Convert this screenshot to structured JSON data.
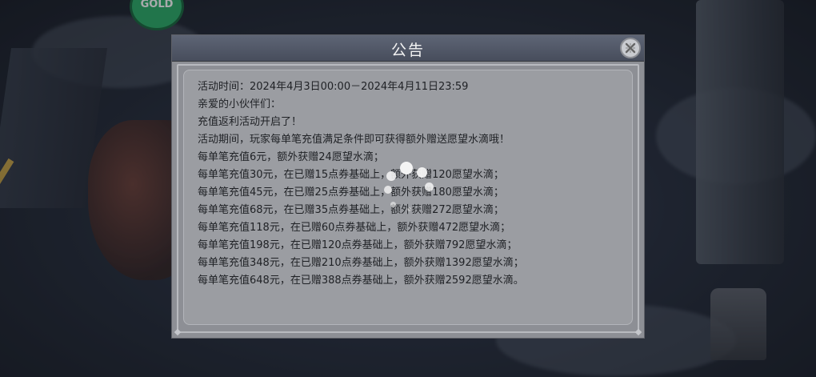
{
  "badge": {
    "label": "GOLD"
  },
  "dialog": {
    "title": "公告",
    "close_icon": "close-icon",
    "lines": [
      "活动时间：2024年4月3日00:00－2024年4月11日23:59",
      "亲爱的小伙伴们：",
      "充值返利活动开启了！",
      "活动期间，玩家每单笔充值满足条件即可获得额外赠送愿望水滴哦！",
      "每单笔充值6元，额外获赠24愿望水滴；",
      "每单笔充值30元，在已赠15点券基础上，额外获赠120愿望水滴；",
      "每单笔充值45元，在已赠25点券基础上，额外获赠180愿望水滴；",
      "每单笔充值68元，在已赠35点券基础上，额外获赠272愿望水滴；",
      "每单笔充值118元，在已赠60点券基础上，额外获赠472愿望水滴；",
      "每单笔充值198元，在已赠120点券基础上，额外获赠792愿望水滴；",
      "每单笔充值348元，在已赠210点券基础上，额外获赠1392愿望水滴；",
      "每单笔充值648元，在已赠388点券基础上，额外获赠2592愿望水滴。"
    ]
  },
  "spinner_icon": "loading-spinner-icon"
}
